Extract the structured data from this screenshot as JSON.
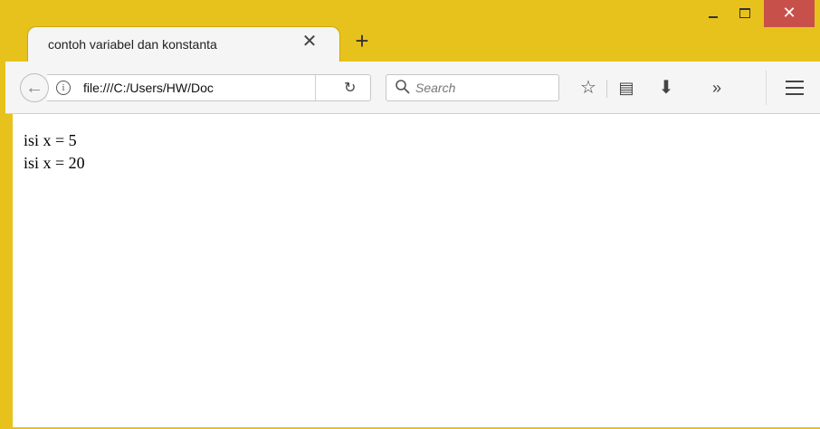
{
  "tab": {
    "title": "contoh variabel dan konstanta",
    "close": "✕"
  },
  "newtab": "+",
  "window_controls": {
    "close": "✕"
  },
  "toolbar": {
    "back": "←",
    "info": "i",
    "url": "file:///C:/Users/HW/Doc",
    "reload": "↻",
    "search_placeholder": "Search",
    "bookmark": "☆",
    "reader": "▤",
    "download": "⬇",
    "overflow": "»"
  },
  "content": {
    "lines": [
      "isi x = 5",
      "isi x = 20"
    ]
  },
  "colors": {
    "titlebar": "#e8c21c",
    "close_button": "#c7504b"
  }
}
